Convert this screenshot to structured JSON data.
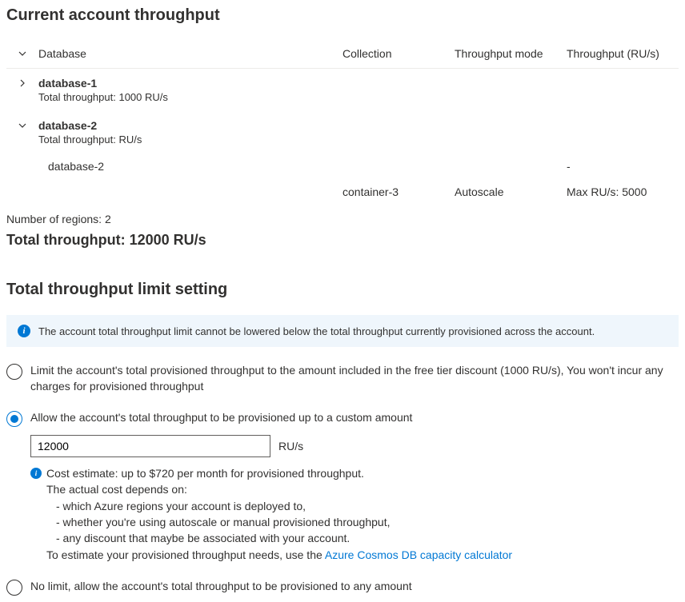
{
  "sections": {
    "current": "Current account throughput",
    "limit": "Total throughput limit setting"
  },
  "table": {
    "headers": {
      "database": "Database",
      "collection": "Collection",
      "mode": "Throughput mode",
      "throughput": "Throughput (RU/s)"
    },
    "databases": [
      {
        "name": "database-1",
        "subtext": "Total throughput: 1000 RU/s",
        "expanded": false
      },
      {
        "name": "database-2",
        "subtext": "Total throughput: RU/s",
        "expanded": true,
        "rows": [
          {
            "database": "database-2",
            "collection": "",
            "mode": "",
            "throughput": "-"
          },
          {
            "database": "",
            "collection": "container-3",
            "mode": "Autoscale",
            "throughput": "Max RU/s: 5000"
          }
        ]
      }
    ]
  },
  "regions": {
    "label": "Number of regions: 2"
  },
  "total": "Total throughput: 12000 RU/s",
  "banner": {
    "text": "The account total throughput limit cannot be lowered below the total throughput currently provisioned across the account."
  },
  "options": {
    "free_tier": "Limit the account's total provisioned throughput to the amount included in the free tier discount (1000 RU/s), You won't incur any charges for provisioned throughput",
    "custom": "Allow the account's total throughput to be provisioned up to a custom amount",
    "custom_value": "12000",
    "unit": "RU/s",
    "no_limit": "No limit, allow the account's total throughput to be provisioned to any amount"
  },
  "cost": {
    "line1": "Cost estimate: up to $720 per month for provisioned throughput.",
    "line2": "The actual cost depends on:",
    "bullet1": "- which Azure regions your account is deployed to,",
    "bullet2": "- whether you're using autoscale or manual provisioned throughput,",
    "bullet3": "- any discount that maybe be associated with your account.",
    "line3_prefix": "To estimate your provisioned throughput needs, use the ",
    "link": "Azure Cosmos DB capacity calculator"
  }
}
